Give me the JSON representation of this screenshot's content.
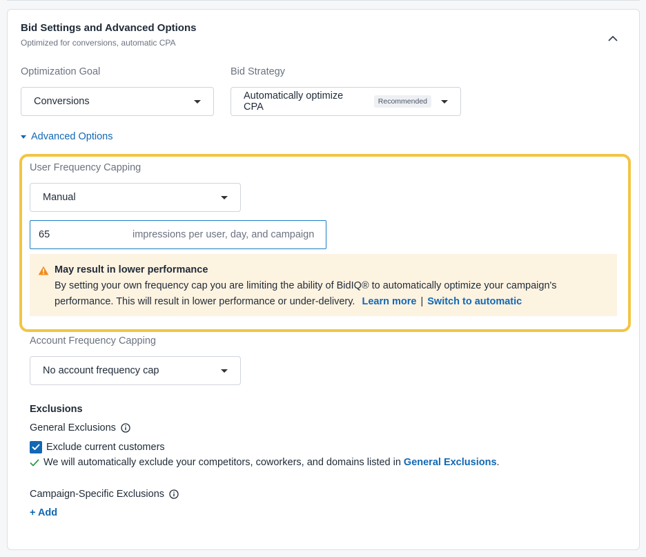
{
  "header": {
    "title": "Bid Settings and Advanced Options",
    "subtitle": "Optimized for conversions, automatic CPA"
  },
  "optimization_goal": {
    "label": "Optimization Goal",
    "value": "Conversions"
  },
  "bid_strategy": {
    "label": "Bid Strategy",
    "value": "Automatically optimize CPA",
    "badge": "Recommended"
  },
  "advanced_toggle": {
    "label": "Advanced Options"
  },
  "user_frequency": {
    "label": "User Frequency Capping",
    "mode": "Manual",
    "value": "65",
    "suffix": "impressions per user, day, and campaign"
  },
  "warning": {
    "title": "May result in lower performance",
    "body": "By setting your own frequency cap you are limiting the ability of BidIQ® to automatically optimize your campaign's performance. This will result in lower performance or under-delivery.",
    "learn_more": "Learn more",
    "separator": "|",
    "switch_link": "Switch to automatic"
  },
  "account_frequency": {
    "label": "Account Frequency Capping",
    "value": "No account frequency cap"
  },
  "exclusions": {
    "heading": "Exclusions",
    "general_label": "General Exclusions",
    "exclude_customers": "Exclude current customers",
    "auto_note_prefix": "We will automatically exclude your competitors, coworkers, and domains listed in",
    "auto_note_link": "General Exclusions",
    "auto_note_suffix": ".",
    "campaign_label": "Campaign-Specific Exclusions",
    "add_label": "+ Add"
  },
  "colors": {
    "accent": "#1168b5",
    "highlight": "#f2c544",
    "warning_bg": "#fdf3e1",
    "warning_icon": "#f08c1e",
    "check_green": "#2e9a4b"
  }
}
